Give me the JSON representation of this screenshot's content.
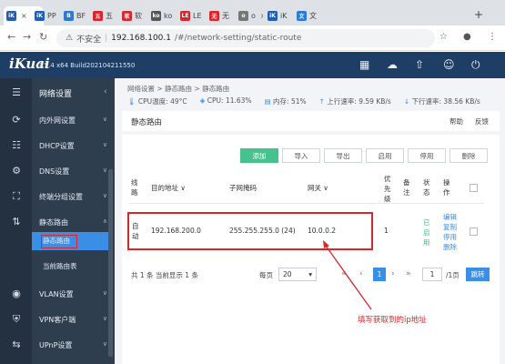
{
  "browser": {
    "tabs": [
      {
        "favicon": "iK",
        "color": "#1f5fb5",
        "label": ""
      },
      {
        "favicon": "iK",
        "color": "#1f5fb5",
        "label": "PP"
      },
      {
        "favicon": "B",
        "color": "#2b7bd6",
        "label": "BF"
      },
      {
        "favicon": "五",
        "color": "#d9262c",
        "label": "五"
      },
      {
        "favicon": "软",
        "color": "#d9262c",
        "label": "软"
      },
      {
        "favicon": "ko",
        "color": "#555",
        "label": "ko"
      },
      {
        "favicon": "LE",
        "color": "#d9262c",
        "label": "LE"
      },
      {
        "favicon": "无",
        "color": "#d9262c",
        "label": "无"
      },
      {
        "favicon": "o",
        "color": "#777",
        "label": "o"
      },
      {
        "favicon": "iK",
        "color": "#1f5fb5",
        "label": "iK"
      },
      {
        "favicon": "文",
        "color": "#2b7bd6",
        "label": "文"
      }
    ],
    "url_warning": "不安全",
    "url_host": "192.168.100.1",
    "url_path": "/#/network-setting/static-route"
  },
  "app": {
    "logo": "iKuai",
    "version": "3.5.4 x64 Build202104211550"
  },
  "sidebar": {
    "section_title": "网络设置",
    "items": [
      {
        "icon": "wan-icon",
        "glyph": "⟳",
        "label": "内外网设置"
      },
      {
        "icon": "dhcp-icon",
        "glyph": "☷",
        "label": "DHCP设置"
      },
      {
        "icon": "dns-icon",
        "glyph": "⚙",
        "label": "DNS设置"
      },
      {
        "icon": "terminal-group-icon",
        "glyph": "⛶",
        "label": "终端分组设置"
      },
      {
        "icon": "static-route-icon",
        "glyph": "⇅",
        "label": "静态路由"
      }
    ],
    "sub_items": [
      "静态路由",
      "当前路由表"
    ],
    "items_after": [
      {
        "icon": "wifi-icon",
        "glyph": "◉",
        "label": "VLAN设置"
      },
      {
        "icon": "vpn-icon",
        "glyph": "⛨",
        "label": "VPN客户端"
      },
      {
        "icon": "upnp-icon",
        "glyph": "⇆",
        "label": "UPnP设置"
      }
    ]
  },
  "main": {
    "breadcrumb": "网络设置 > 静态路由 > 静态路由",
    "status": {
      "cpu_temp": "CPU温度: 49°C",
      "cpu": "CPU: 11.63%",
      "memory": "内存: 51%",
      "up_rate": "上行速率: 9.59 KB/s",
      "down_rate": "下行速率: 38.56 KB/s"
    },
    "page_title": "静态路由",
    "help": "帮助",
    "feedback": "反馈",
    "actions": [
      "添加",
      "导入",
      "导出",
      "启用",
      "停用",
      "删除"
    ],
    "table": {
      "headers": [
        "线路",
        "目的地址",
        "子网掩码",
        "网关",
        "优先级",
        "备注",
        "状态",
        "操作"
      ],
      "rows": [
        {
          "line": "自动",
          "destination": "192.168.200.0",
          "netmask": "255.255.255.0 (24)",
          "gateway": "10.0.0.2",
          "priority": "1",
          "note": "",
          "status": "已启用",
          "ops": [
            "编辑",
            "复制",
            "停用",
            "删除"
          ]
        }
      ]
    },
    "pagination": {
      "summary": "共 1 条 当前显示 1 条",
      "per_page_label": "每页",
      "per_page": "20",
      "current": "1",
      "goto_value": "1",
      "total_pages": "/1页",
      "jump": "跳转"
    },
    "annotation": "填写获取到的ip地址"
  }
}
